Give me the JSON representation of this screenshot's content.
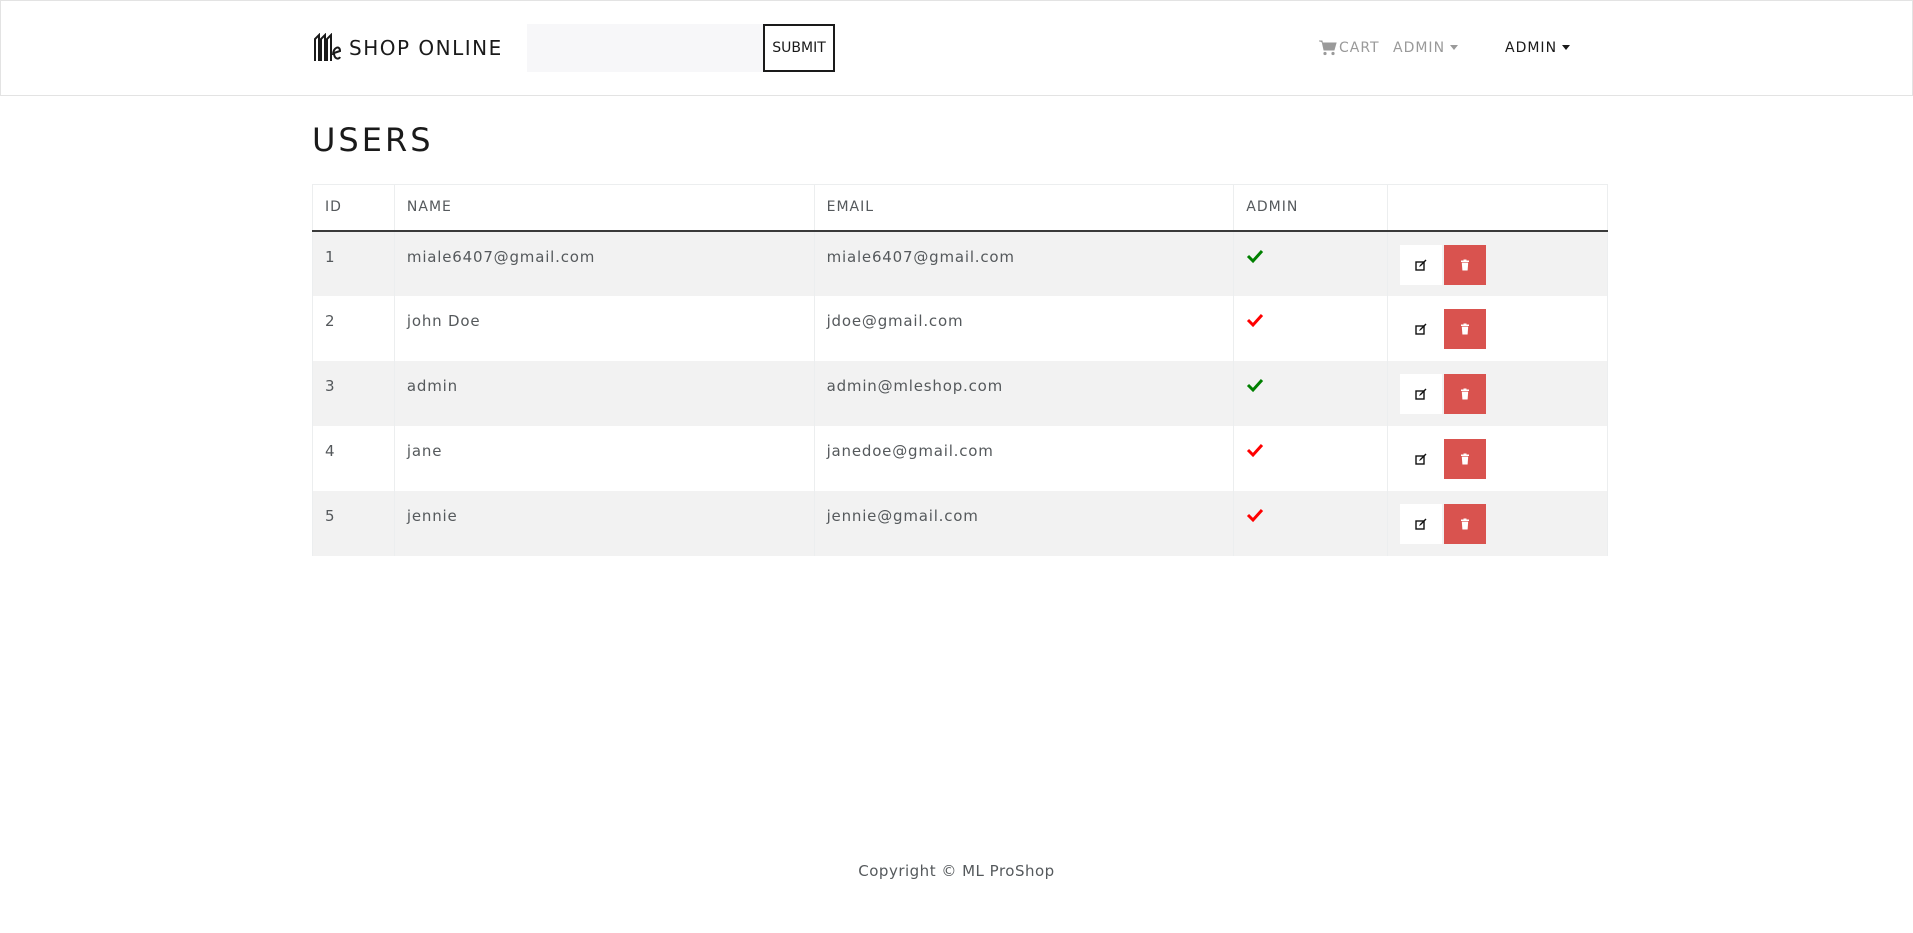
{
  "header": {
    "brand_text": "SHOP ONLINE",
    "search": {
      "value": "",
      "placeholder": ""
    },
    "submit_label": "SUBMIT",
    "cart_label": "CART",
    "admin_menu_label": "ADMIN",
    "user_menu_label": "ADMIN"
  },
  "page": {
    "title": "USERS"
  },
  "table": {
    "columns": [
      "ID",
      "NAME",
      "EMAIL",
      "ADMIN",
      ""
    ],
    "rows": [
      {
        "id": "1",
        "name": "miale6407@gmail.com",
        "email": "miale6407@gmail.com",
        "is_admin": true
      },
      {
        "id": "2",
        "name": "john Doe",
        "email": "jdoe@gmail.com",
        "is_admin": false
      },
      {
        "id": "3",
        "name": "admin",
        "email": "admin@mleshop.com",
        "is_admin": true
      },
      {
        "id": "4",
        "name": "jane",
        "email": "janedoe@gmail.com",
        "is_admin": false
      },
      {
        "id": "5",
        "name": "jennie",
        "email": "jennie@gmail.com",
        "is_admin": false
      }
    ]
  },
  "footer": {
    "copyright": "Copyright © ML ProShop"
  },
  "colors": {
    "admin_true": "#008000",
    "admin_false": "#ff0000",
    "delete_button": "#d9534f"
  },
  "icons": {
    "cart": "cart-icon",
    "admin_check": "check-icon",
    "edit": "edit-icon",
    "delete": "trash-icon"
  }
}
